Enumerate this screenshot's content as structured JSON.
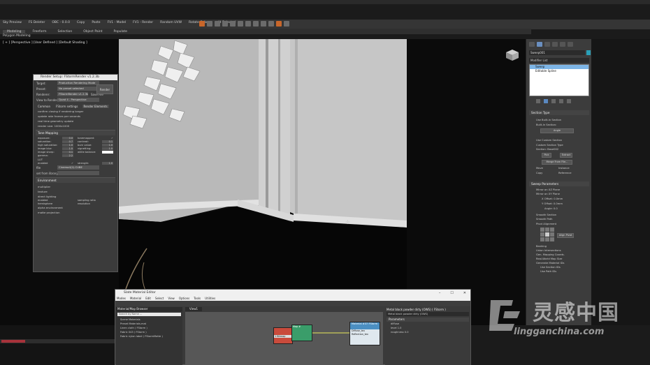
{
  "menubar": {
    "items": [
      "Sky Preview",
      "FS Deleter",
      "OBC - 0.0.0",
      "Copy",
      "Paste",
      "FV1 - Model",
      "FV1 - Render",
      "Random UVW",
      "Rotate Cube",
      "edit Selected"
    ]
  },
  "ribbon": {
    "tabs": [
      "Modeling",
      "Freeform",
      "Selection",
      "Object Paint",
      "Populate"
    ],
    "active": "Modeling",
    "sub_label": "Polygon Modeling"
  },
  "viewport": {
    "label": "[ + ] [Perspective ] [User Defined ] [Default Shading ]"
  },
  "render_setup": {
    "title": "Render Setup: FStormRender v1.2.3b",
    "target_label": "Target:",
    "target_value": "Production Rendering Mode",
    "preset_label": "Preset:",
    "preset_value": "No preset selected",
    "renderer_label": "Renderer:",
    "renderer_value": "FStormRender v1.2.3b",
    "save_file": "Save File",
    "view_label": "View to Render:",
    "view_value": "Quad 4 - Perspective",
    "render_button": "Render",
    "tabs": [
      "Common",
      "FStorm settings",
      "Render Elements"
    ],
    "active_tab": "FStorm settings",
    "lines": [
      "confirm closing if rendering longer",
      "update rate frames per seconds",
      "real time geometry update",
      "render size: 1000x1000"
    ],
    "tone_section": "Tone Mapping",
    "tone_params": [
      {
        "label": "exposure:",
        "value": "0.0"
      },
      {
        "label": "tonemapped:",
        "value": "✓"
      },
      {
        "label": "saturation:",
        "value": "0.7"
      },
      {
        "label": "contrast:",
        "value": "0.1"
      },
      {
        "label": "high saturation:",
        "value": "1.0"
      },
      {
        "label": "burn value:",
        "value": "1.0"
      },
      {
        "label": "image blur:",
        "value": "1.0"
      },
      {
        "label": "vignetting:",
        "value": "1.0"
      },
      {
        "label": "image sharp:",
        "value": "0.1"
      },
      {
        "label": "white balance:",
        "value": ""
      },
      {
        "label": "gamma:",
        "value": "2.2"
      }
    ],
    "lut_label": "LUT",
    "lut_enabled": "enabled",
    "lut_strength": "strength:",
    "lut_strength_value": "1.0",
    "lut_file_label": "file",
    "lut_file_value": "Cinema4(2).CUBE",
    "lut_library": "set from library",
    "env_section": "Environment",
    "env_lines": [
      "multiplier",
      "texture",
      "direct lighting",
      "enabled",
      "sampling ratio",
      "hemisphere",
      "resolution",
      "alpha environment",
      "matte projection"
    ]
  },
  "command_panel": {
    "object_name": "Sweep001",
    "modifier_list": "Modifier List",
    "stack": [
      "Sweep",
      "Editable Spline"
    ],
    "selected_stack": "Sweep",
    "section_type": "Section Type",
    "section_lines": [
      "Use Built-In Section",
      "Built-In Section:",
      "Angle",
      "Use Custom Section",
      "Custom Section Type",
      "Section: Base002",
      "Pick",
      "Extract",
      "Merge From File...",
      "Move",
      "Instance",
      "Copy",
      "Reference"
    ],
    "sweep_params": "Sweep Parameters",
    "sweep_lines": [
      "Mirror on XZ Plane",
      "Mirror on XY Plane",
      "X Offset: 0.0mm",
      "Y Offset: 0.0mm",
      "Angle: 0.0",
      "Smooth Section",
      "Smooth Path",
      "Pivot Alignment",
      "Align Pivot",
      "Banking",
      "Union Intersections",
      "Gen. Mapping Coords.",
      "Real-World Map Size",
      "Generate Material IDs",
      "Use Section IDs",
      "Use Path IDs"
    ]
  },
  "slate": {
    "title": "Slate Material Editor",
    "menu": [
      "Modes",
      "Material",
      "Edit",
      "Select",
      "View",
      "Options",
      "Tools",
      "Utilities"
    ],
    "browser_title": "Material/Map Browser",
    "search_placeholder": "Search by Name ...",
    "browser_items": [
      "Scene Materials",
      "Preset Materials.mat",
      "Linen cloth ( FStorm )",
      "Fabric 043 ( FStorm )",
      "Fabric nylon label ( FStormMatte )"
    ],
    "view_tab": "View1",
    "node_bitmap": "1 Bitmap",
    "node_texture": "Map #",
    "node_material": "Material #37 FStorm",
    "node_ports": [
      "Diffuse_tex",
      "Reflection_tex"
    ],
    "params_title": "Metal black powder dirty (OWS) ( FStorm )",
    "params_name": "Metal black powder dirty (OWS)",
    "params_section": "Parameters",
    "params_lines": [
      "diffuse",
      "level 1.0",
      "roughness 0.0"
    ]
  },
  "watermark": {
    "cn": "灵感中国",
    "url": "lingganchina.com"
  }
}
